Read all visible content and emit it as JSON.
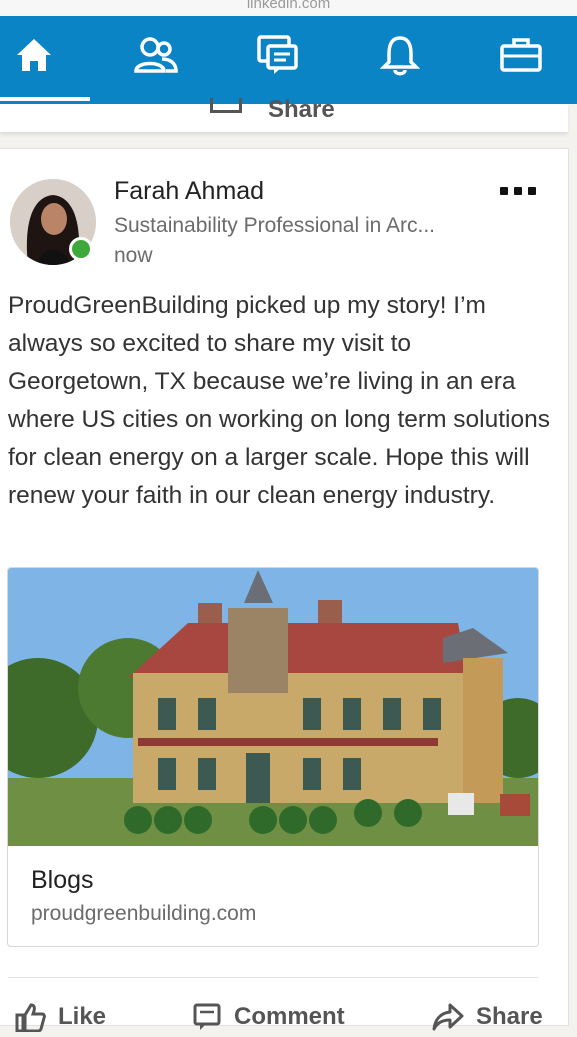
{
  "browser": {
    "url_text": "linkedin.com"
  },
  "nav": {
    "items": [
      {
        "icon": "home-icon"
      },
      {
        "icon": "people-icon"
      },
      {
        "icon": "messaging-icon"
      },
      {
        "icon": "bell-icon"
      },
      {
        "icon": "briefcase-icon"
      }
    ],
    "accent_color": "#0a84c5"
  },
  "share_bar": {
    "label": "Share"
  },
  "post": {
    "author": "Farah Ahmad",
    "headline": "Sustainability Professional in Arc...",
    "time": "now",
    "presence_color": "#3fa83a",
    "text": "ProudGreenBuilding picked up my story! I’m always so excited to share my visit to Georgetown, TX because we’re living in an era where US cities on working on long term solutions for clean energy on a larger scale. Hope this will renew your faith in our clean energy industry.",
    "link": {
      "title": "Blogs",
      "domain": "proudgreenbuilding.com"
    }
  },
  "actions": {
    "like": "Like",
    "comment": "Comment",
    "share": "Share"
  }
}
